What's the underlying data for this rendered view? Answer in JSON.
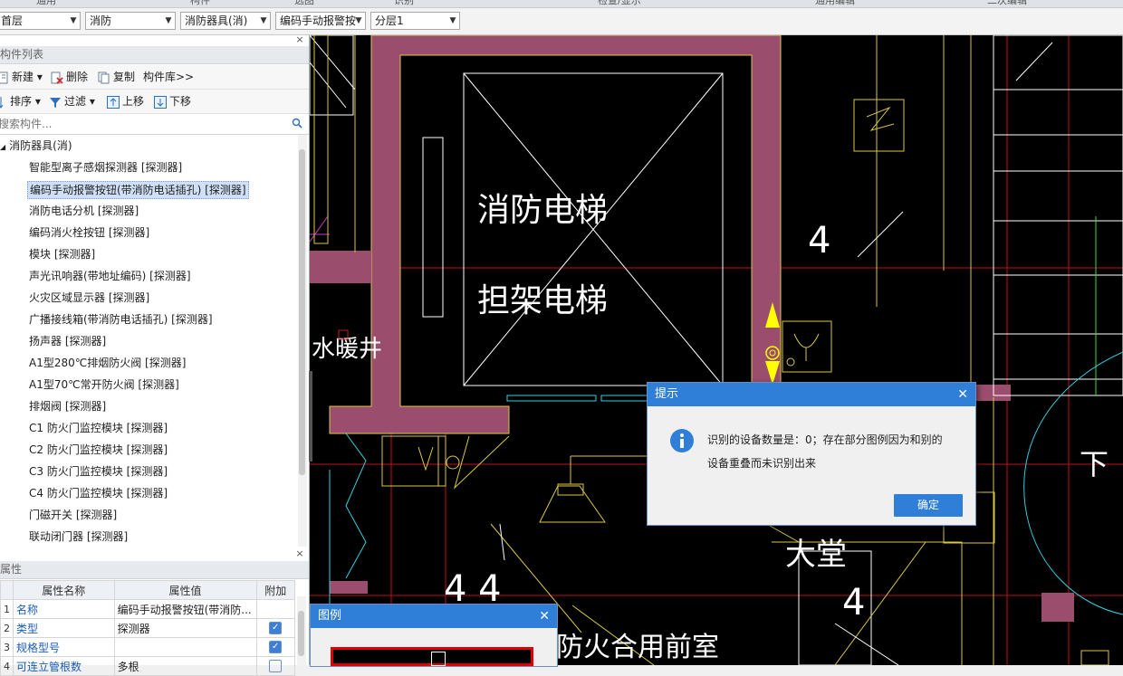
{
  "ribbon": {
    "labels": [
      "通用",
      "构件",
      "选图",
      "识别",
      "检查/显示",
      "通用编辑",
      "二次编辑"
    ]
  },
  "toolbar": {
    "floor": "首层",
    "discipline": "消防",
    "category": "消防器具(消)",
    "component": "编码手动报警按",
    "layer": "分层1"
  },
  "component_list": {
    "title": "构件列表",
    "new_label": "新建",
    "delete_label": "删除",
    "copy_label": "复制",
    "library_label": "构件库>>",
    "sort_label": "排序",
    "filter_label": "过滤",
    "up_label": "上移",
    "down_label": "下移",
    "search_placeholder": "搜索构件...",
    "root": "消防器具(消)",
    "items": [
      "智能型离子感烟探测器 [探测器]",
      "编码手动报警按钮(带消防电话插孔) [探测器]",
      "消防电话分机 [探测器]",
      "编码消火栓按钮 [探测器]",
      "模块 [探测器]",
      "声光讯响器(带地址编码) [探测器]",
      "火灾区域显示器 [探测器]",
      "广播接线箱(带消防电话插孔) [探测器]",
      "扬声器 [探测器]",
      "A1型280℃排烟防火阀 [探测器]",
      "A1型70℃常开防火阀 [探测器]",
      "排烟阀 [探测器]",
      "C1 防火门监控模块 [探测器]",
      "C2 防火门监控模块 [探测器]",
      "C3 防火门监控模块 [探测器]",
      "C4 防火门监控模块 [探测器]",
      "门磁开关 [探测器]",
      "联动闭门器 [探测器]"
    ],
    "selected_index": 1
  },
  "properties": {
    "title": "属性",
    "headers": [
      "属性名称",
      "属性值",
      "附加"
    ],
    "rows": [
      {
        "num": "1",
        "name": "名称",
        "value": "编码手动报警按钮(带消防...",
        "checked": false,
        "show_box": false
      },
      {
        "num": "2",
        "name": "类型",
        "value": "探测器",
        "checked": true,
        "show_box": true
      },
      {
        "num": "3",
        "name": "规格型号",
        "value": "",
        "checked": true,
        "show_box": true
      },
      {
        "num": "4",
        "name": "可连立管根数",
        "value": "多根",
        "checked": false,
        "show_box": true
      }
    ]
  },
  "cad_labels": {
    "elevator_fire": "消防电梯",
    "elevator_stretcher": "担架电梯",
    "water_shaft": "水暖井",
    "lobby": "大堂",
    "shared_front_room": "防火合用前室",
    "stair_down": "下",
    "dim_a": "4",
    "dim_b": "4",
    "dim_c": "4 4"
  },
  "prompt_dialog": {
    "title": "提示",
    "message_line1": "识别的设备数量是：0；存在部分图例因为和别的",
    "message_line2": "设备重叠而未识别出来",
    "ok_label": "确定"
  },
  "legend_dialog": {
    "title": "图例"
  },
  "colors": {
    "accent": "#2f7fd9",
    "wall": "#9b4d6e",
    "cad_bg": "#000000"
  }
}
